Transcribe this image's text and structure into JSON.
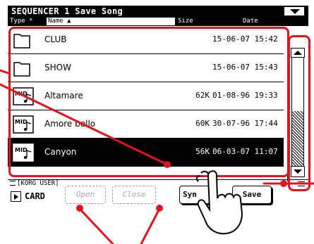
{
  "window": {
    "title": "SEQUENCER 1  Save Song"
  },
  "columns": {
    "type": "Type *",
    "name": "Name ▲",
    "size": "Size",
    "date": "Date"
  },
  "files": [
    {
      "icon": "folder-icon",
      "name": "CLUB",
      "size": "",
      "date": "15-06-07 15:42",
      "selected": false
    },
    {
      "icon": "folder-icon",
      "name": "SHOW",
      "size": "",
      "date": "15-06-07 15:43",
      "selected": false
    },
    {
      "icon": "midi-file-icon",
      "name": "Altamare",
      "size": "62K",
      "date": "01-08-96 19:33",
      "selected": false
    },
    {
      "icon": "midi-file-icon",
      "name": "Amore bello",
      "size": "60K",
      "date": "30-07-96 17:44",
      "selected": false
    },
    {
      "icon": "midi-file-icon",
      "name": "Canyon",
      "size": "56K",
      "date": "06-03-07 11:07",
      "selected": true
    }
  ],
  "path": {
    "label": "[KORG USER]"
  },
  "buttons": {
    "card": "CARD",
    "open": "Open",
    "close": "Close",
    "sync": "Syn",
    "save": "Save"
  },
  "colors": {
    "highlight": "#e0141c",
    "selection": "#000000",
    "background": "#ffffff"
  }
}
